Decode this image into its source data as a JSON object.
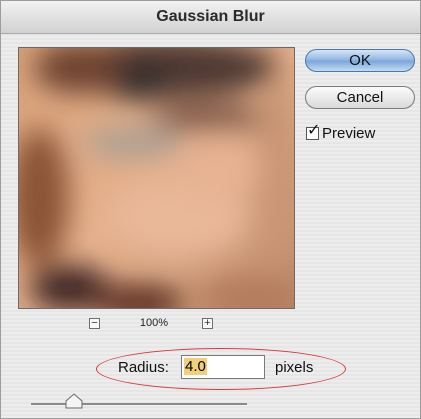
{
  "dialog": {
    "title": "Gaussian Blur",
    "ok_label": "OK",
    "cancel_label": "Cancel",
    "preview_label": "Preview",
    "preview_checked": true
  },
  "zoom": {
    "level": "100%",
    "minus_icon": "minus-icon",
    "plus_icon": "plus-icon"
  },
  "radius": {
    "label": "Radius:",
    "value": "4.0",
    "units": "pixels",
    "highlight_color": "#d83a3a"
  },
  "slider": {
    "fraction": 0.2
  },
  "colors": {
    "default_button": "#8fb6e2",
    "selection": "#f2cf7a"
  }
}
